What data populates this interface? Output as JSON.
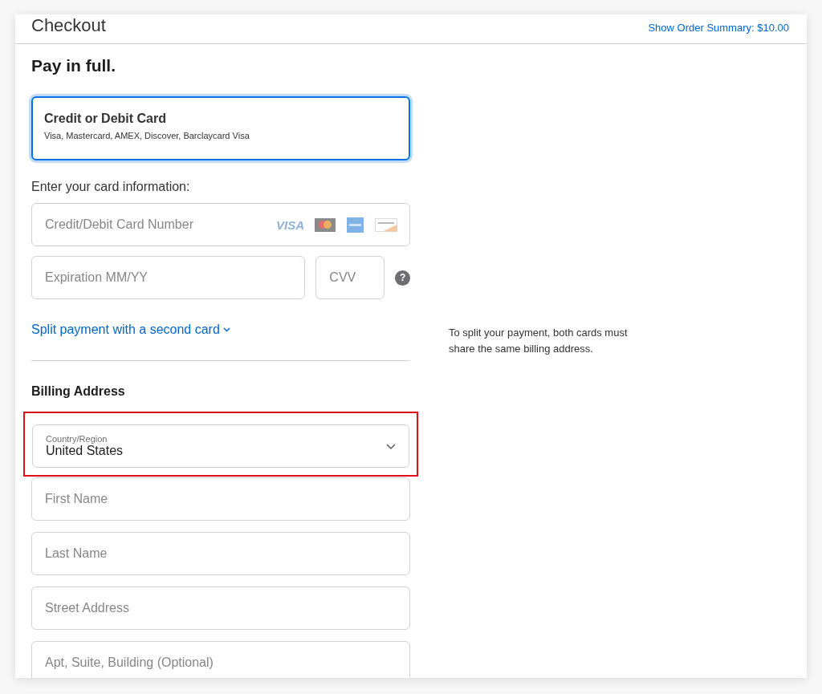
{
  "header": {
    "title": "Checkout",
    "order_summary_link": "Show Order Summary: $10.00"
  },
  "heading": "Pay in full.",
  "payment_options": [
    {
      "title": "Credit or Debit Card",
      "description": "Visa, Mastercard, AMEX, Discover, Barclaycard Visa",
      "selected": true
    }
  ],
  "card_section": {
    "label": "Enter your card information:",
    "card_number": {
      "placeholder": "Credit/Debit Card Number"
    },
    "card_logos": [
      {
        "kind": "visa",
        "text": "VISA"
      },
      {
        "kind": "mastercard"
      },
      {
        "kind": "amex"
      },
      {
        "kind": "discover"
      }
    ],
    "expiration": {
      "placeholder": "Expiration MM/YY"
    },
    "cvv": {
      "placeholder": "CVV"
    },
    "cvv_help": "?"
  },
  "split_payment": {
    "link": "Split payment with a second card",
    "note": "To split your payment, both cards must share the same billing address."
  },
  "billing": {
    "title": "Billing Address",
    "country": {
      "label": "Country/Region",
      "value": "United States",
      "highlighted": true
    },
    "fields": [
      {
        "placeholder": "First Name"
      },
      {
        "placeholder": "Last Name"
      },
      {
        "placeholder": "Street Address"
      },
      {
        "placeholder": "Apt, Suite, Building (Optional)"
      }
    ]
  }
}
